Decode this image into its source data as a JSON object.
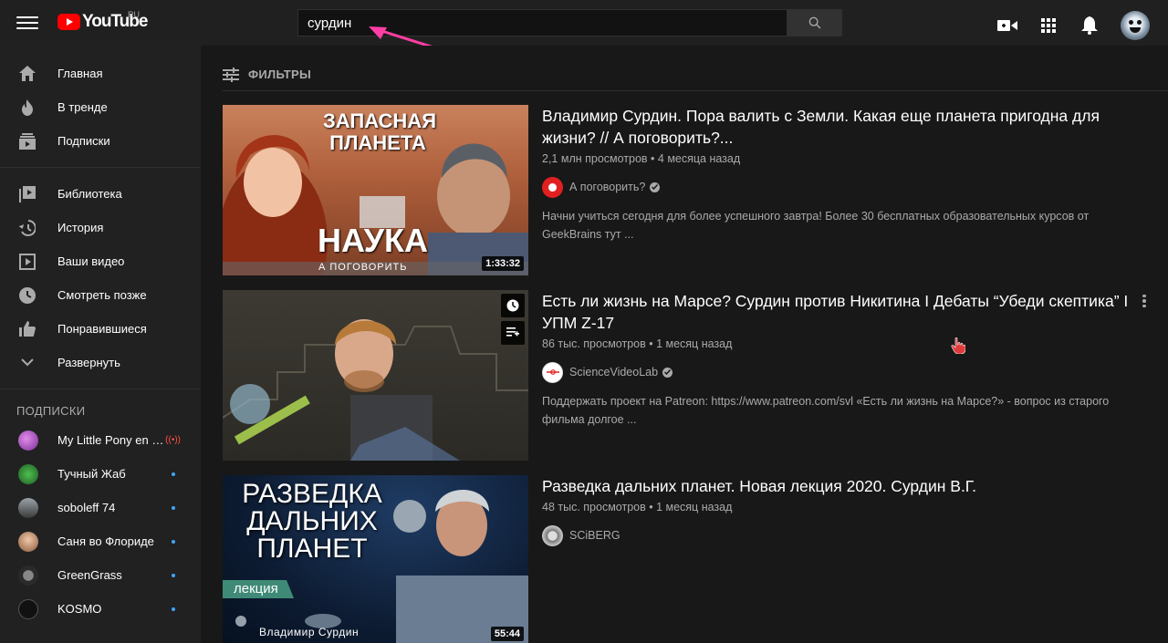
{
  "header": {
    "logo_text": "YouTube",
    "region": "RU",
    "search_value": "сурдин",
    "icons": [
      "menu-icon",
      "video-camera-icon",
      "apps-grid-icon",
      "bell-icon"
    ]
  },
  "sidebar": {
    "primary": [
      {
        "label": "Главная",
        "icon": "home-icon"
      },
      {
        "label": "В тренде",
        "icon": "flame-icon"
      },
      {
        "label": "Подписки",
        "icon": "subscriptions-icon"
      }
    ],
    "library": [
      {
        "label": "Библиотека",
        "icon": "library-icon"
      },
      {
        "label": "История",
        "icon": "history-icon"
      },
      {
        "label": "Ваши видео",
        "icon": "your-videos-icon"
      },
      {
        "label": "Смотреть позже",
        "icon": "clock-icon"
      },
      {
        "label": "Понравившиеся",
        "icon": "thumb-up-icon"
      },
      {
        "label": "Развернуть",
        "icon": "chevron-down-icon"
      }
    ],
    "subscriptions_heading": "ПОДПИСКИ",
    "subscriptions": [
      {
        "name": "My Little Pony en E...",
        "status": "live",
        "color": "#b04dc7"
      },
      {
        "name": "Тучный Жаб",
        "status": "new",
        "color": "#2f8a3b"
      },
      {
        "name": "soboleff 74",
        "status": "new",
        "color": "#6a6a6a"
      },
      {
        "name": "Саня во Флориде",
        "status": "new",
        "color": "#c89a7a"
      },
      {
        "name": "GreenGrass",
        "status": "new",
        "color": "#444444"
      },
      {
        "name": "KOSMO",
        "status": "new",
        "color": "#1b1b1b"
      }
    ]
  },
  "main": {
    "filters_label": "ФИЛЬТРЫ",
    "videos": [
      {
        "title": "Владимир Сурдин. Пора валить с Земли. Какая еще планета пригодна для жизни? // А поговорить?...",
        "meta": "2,1 млн просмотров • 4 месяца назад",
        "channel": "А поговорить?",
        "verified": true,
        "description": "Начни учиться сегодня для более успешного завтра! Более 30 бесплатных образовательных курсов от GeekBrains тут ...",
        "duration": "1:33:32",
        "thumb_text_top": "ЗАПАСНАЯ ПЛАНЕТА",
        "thumb_text_logo": "НАУКА",
        "thumb_text_sub": "А ПОГОВОРИТЬ"
      },
      {
        "title": "Есть ли жизнь на Марсе? Сурдин против Никитина I Дебаты “Убеди скептика” I УПМ Z-17",
        "meta": "86 тыс. просмотров • 1 месяц назад",
        "channel": "ScienceVideoLab",
        "verified": true,
        "description": "Поддержать проект на Patreon: https://www.patreon.com/svl «Есть ли жизнь на Марсе?» - вопрос из старого фильма долгое ...",
        "duration": ""
      },
      {
        "title": "Разведка дальних планет. Новая лекция 2020. Сурдин В.Г.",
        "meta": "48 тыс. просмотров • 1 месяц назад",
        "channel": "SCiBERG",
        "verified": false,
        "description": "",
        "duration": "55:44",
        "thumb_text_top": "РАЗВЕДКА ДАЛЬНИХ ПЛАНЕТ",
        "thumb_text_tag": "лекция",
        "thumb_text_bottom": "Владимир Сурдин"
      }
    ]
  },
  "colors": {
    "brand_red": "#ff0000",
    "accent_blue": "#3ea6ff",
    "annotation_pink": "#ff3ea5"
  }
}
